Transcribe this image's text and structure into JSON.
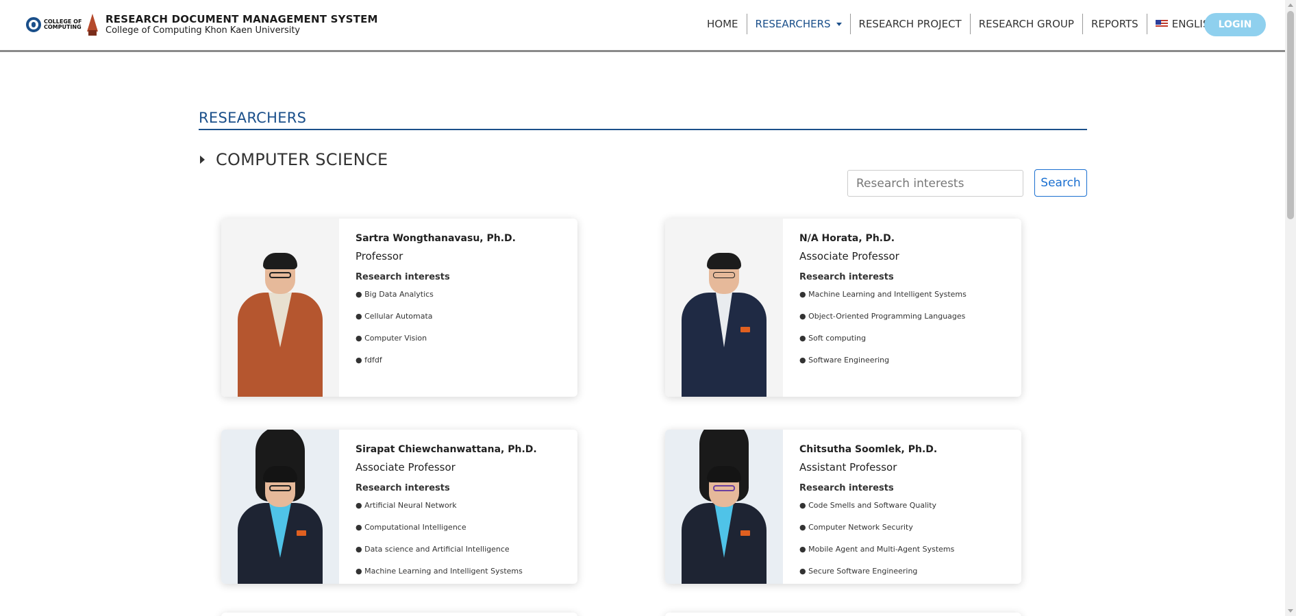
{
  "header": {
    "logo_text_line1": "COLLEGE OF",
    "logo_text_line2": "COMPUTING",
    "title": "RESEARCH DOCUMENT MANAGEMENT SYSTEM",
    "subtitle": "College of Computing Khon Kaen University",
    "nav": {
      "home": "HOME",
      "researchers": "RESEARCHERS",
      "research_project": "RESEARCH PROJECT",
      "research_group": "RESEARCH GROUP",
      "reports": "REPORTS",
      "language": "ENGLISH"
    },
    "login": "LOGIN"
  },
  "main": {
    "section_title": "RESEARCHERS",
    "department": "COMPUTER SCIENCE",
    "search": {
      "placeholder": "Research interests",
      "button": "Search"
    },
    "research_interests_label": "Research interests",
    "researchers": [
      {
        "name": "Sartra Wongthanavasu, Ph.D.",
        "position": "Professor",
        "interests": [
          "Big Data Analytics",
          "Cellular Automata",
          "Computer Vision",
          "fdfdf"
        ]
      },
      {
        "name": "N/A Horata, Ph.D.",
        "position": "Associate Professor",
        "interests": [
          "Machine Learning and Intelligent Systems",
          "Object-Oriented Programming Languages",
          "Soft computing",
          "Software Engineering"
        ]
      },
      {
        "name": "Sirapat Chiewchanwattana, Ph.D.",
        "position": "Associate Professor",
        "interests": [
          "Artificial Neural Network",
          "Computational Intelligence",
          "Data science and Artificial Intelligence",
          "Machine Learning and Intelligent Systems"
        ]
      },
      {
        "name": "Chitsutha Soomlek, Ph.D.",
        "position": "Assistant Professor",
        "interests": [
          "Code Smells and Software Quality",
          "Computer Network Security",
          "Mobile Agent and Multi-Agent Systems",
          "Secure Software Engineering"
        ]
      }
    ]
  },
  "colors": {
    "primary": "#1a4f8a",
    "login_button": "#8fd0ee",
    "search_button": "#1a6fd0"
  }
}
